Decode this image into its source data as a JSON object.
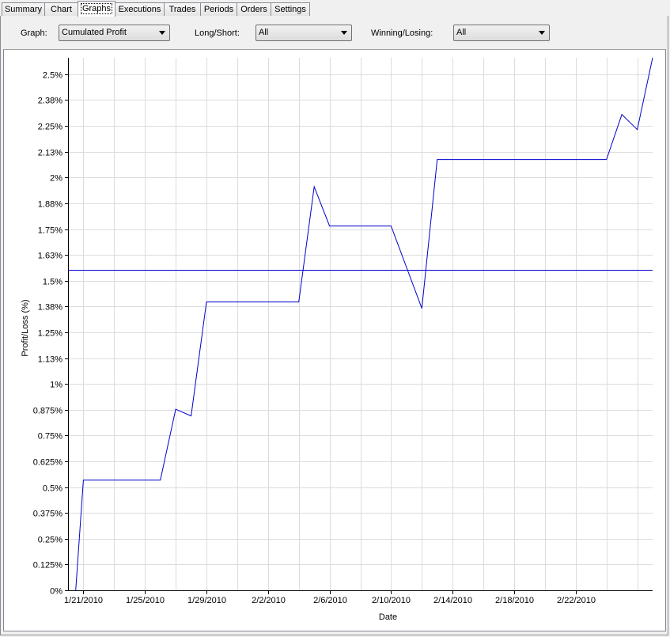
{
  "tabs": [
    {
      "label": "Summary",
      "active": false
    },
    {
      "label": "Chart",
      "active": false
    },
    {
      "label": "Graphs",
      "active": true
    },
    {
      "label": "Executions",
      "active": false
    },
    {
      "label": "Trades",
      "active": false
    },
    {
      "label": "Periods",
      "active": false
    },
    {
      "label": "Orders",
      "active": false
    },
    {
      "label": "Settings",
      "active": false
    }
  ],
  "filters": {
    "graph_label": "Graph:",
    "graph_value": "Cumulated Profit",
    "longshort_label": "Long/Short:",
    "longshort_value": "All",
    "winlose_label": "Winning/Losing:",
    "winlose_value": "All"
  },
  "colors": {
    "series": "#0000cc",
    "grid": "#dcdcdc"
  },
  "chart_data": {
    "type": "line",
    "xlabel": "Date",
    "ylabel": "Profit/Loss (%)",
    "x_tick_labels": [
      "1/21/2010",
      "1/25/2010",
      "1/29/2010",
      "2/2/2010",
      "2/6/2010",
      "2/10/2010",
      "2/14/2010",
      "2/18/2010",
      "2/22/2010"
    ],
    "y_tick_labels": [
      "0%",
      "0.125%",
      "0.25%",
      "0.375%",
      "0.5%",
      "0.625%",
      "0.75%",
      "0.875%",
      "1%",
      "1.13%",
      "1.25%",
      "1.38%",
      "1.5%",
      "1.63%",
      "1.75%",
      "1.88%",
      "2%",
      "2.13%",
      "2.25%",
      "2.38%",
      "2.5%"
    ],
    "x_range": [
      "2010-01-20",
      "2010-02-26"
    ],
    "ylim": [
      0,
      2.58
    ],
    "grid": true,
    "reference_line": {
      "y": 1.552
    },
    "series": [
      {
        "points": [
          {
            "x": "2010-01-20T12:00",
            "y": 0
          },
          {
            "x": "2010-01-21",
            "y": 0.534
          },
          {
            "x": "2010-01-26",
            "y": 0.534
          },
          {
            "x": "2010-01-27",
            "y": 0.877
          },
          {
            "x": "2010-01-28",
            "y": 0.845
          },
          {
            "x": "2010-01-29",
            "y": 1.397
          },
          {
            "x": "2010-02-04",
            "y": 1.397
          },
          {
            "x": "2010-02-05",
            "y": 1.955
          },
          {
            "x": "2010-02-06",
            "y": 1.765
          },
          {
            "x": "2010-02-10",
            "y": 1.765
          },
          {
            "x": "2010-02-12",
            "y": 1.366
          },
          {
            "x": "2010-02-13",
            "y": 2.087
          },
          {
            "x": "2010-02-24",
            "y": 2.087
          },
          {
            "x": "2010-02-25",
            "y": 2.305
          },
          {
            "x": "2010-02-26",
            "y": 2.232
          },
          {
            "x": "2010-02-27",
            "y": 2.58
          }
        ]
      }
    ]
  }
}
